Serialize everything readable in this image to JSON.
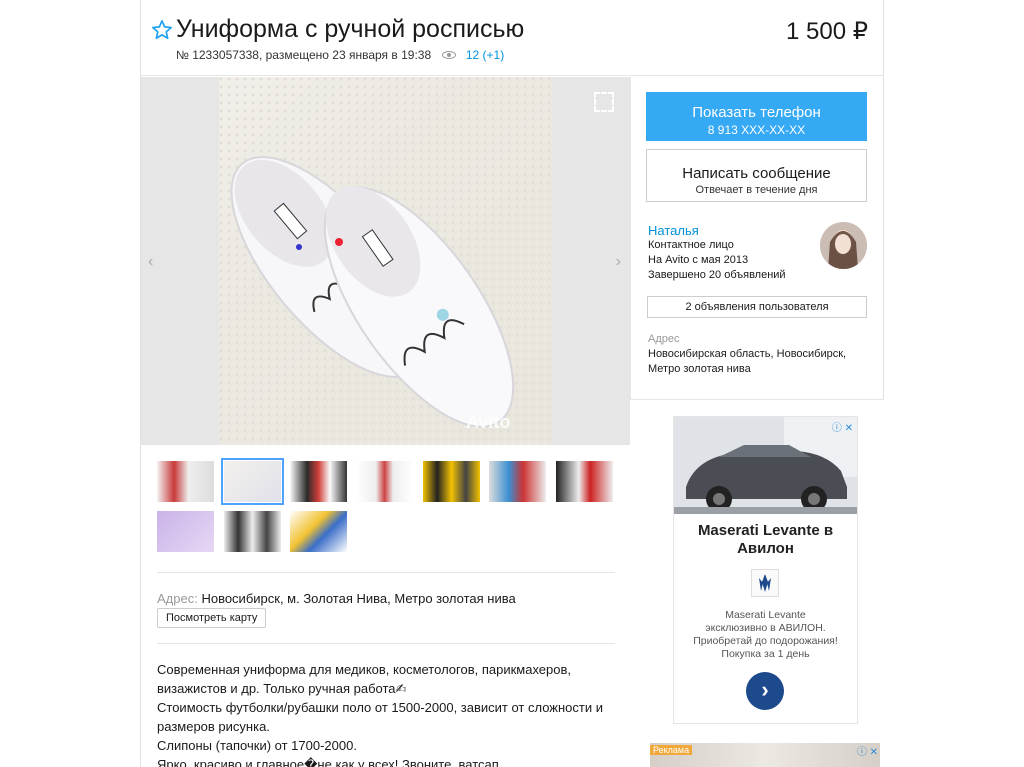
{
  "listing": {
    "title": "Униформа с ручной росписью",
    "price": "1 500 ₽",
    "meta": "№ 1233057338, размещено 23 января в 19:38",
    "views": "12 (+1)"
  },
  "gallery": {
    "watermark": "Avito",
    "thumbnail_count": 10,
    "active_thumbnail": 2
  },
  "location": {
    "label": "Адрес:",
    "value": "Новосибирск, м. Золотая Нива, Метро золотая нива",
    "map_button": "Посмотреть карту"
  },
  "description": [
    "Современная униформа для медиков, косметологов, парикмахеров,",
    "визажистов и др. Только ручная работа✍",
    "Стоимость футболки/рубашки поло от 1500-2000, зависит от сложности и",
    "размеров рисунка.",
    "Слипоны (тапочки) от 1700-2000.",
    "Ярко, красиво и главное�не как у всех! Звоните, ватсап."
  ],
  "contact": {
    "phone_label": "Показать телефон",
    "phone_masked": "8 913 XXX-XX-XX",
    "message_label": "Написать сообщение",
    "message_sub": "Отвечает в течение дня"
  },
  "seller": {
    "name": "Наталья",
    "role": "Контактное лицо",
    "since": "На Avito с мая 2013",
    "completed": "Завершено 20 объявлений",
    "ads_button": "2 объявления пользователя",
    "address_label": "Адрес",
    "address_value": "Новосибирская область, Новосибирск, Метро золотая нива"
  },
  "ad": {
    "title": "Maserati Levante в Авилон",
    "text_lines": [
      "Maserati Levante",
      "эксклюзивно в АВИЛОН.",
      "Приобретай до подорожания!",
      "Покупка за 1 день"
    ],
    "close": "ⓘ ✕",
    "go": "›"
  },
  "ad2": {
    "label": "Реклама",
    "close": "ⓘ ✕"
  },
  "colors": {
    "accent": "#0091d9",
    "phone_button": "#36a9f5",
    "ad_button": "#1d4a8c"
  }
}
